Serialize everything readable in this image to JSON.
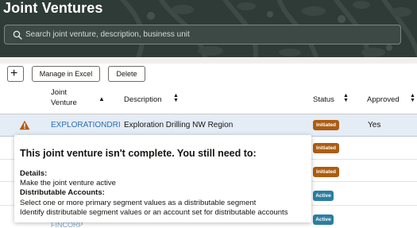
{
  "header": {
    "title": "Joint Ventures",
    "search_placeholder": "Search joint venture, description, business unit"
  },
  "toolbar": {
    "add_label": "+",
    "manage_excel_label": "Manage in Excel",
    "delete_label": "Delete"
  },
  "table": {
    "columns": {
      "joint_venture_line1": "Joint",
      "joint_venture_line2": "Venture",
      "description": "Description",
      "status": "Status",
      "approved": "Approved"
    },
    "rows": [
      {
        "joint_venture": "EXPLORATIONDRI",
        "description": "Exploration Drilling NW Region",
        "status": "Initiated",
        "approved": "Yes",
        "warning_icon": "warning-icon"
      },
      {
        "status": "Initiated"
      },
      {
        "status": "Initiated"
      },
      {
        "status": "Active"
      },
      {
        "status": "Active"
      }
    ]
  },
  "popup": {
    "title": "This joint venture isn't complete. You still need to:",
    "details_heading": "Details:",
    "details_item1": "Make the joint venture active",
    "accounts_heading": "Distributable Accounts:",
    "accounts_item1": "Select one or more primary segment values as a distributable segment",
    "accounts_item2": "Identify distributable segment values or an account set for distributable accounts"
  },
  "colors": {
    "header_bg": "#2f3b37",
    "link": "#2a6fb2",
    "badge_initiated": "#ad5c11",
    "badge_active": "#2c7ea0",
    "selected_row": "#e4ecf6",
    "warning": "#b35c0e"
  },
  "icons": [
    "search-icon",
    "plus-icon",
    "sort-icon",
    "warning-icon"
  ]
}
